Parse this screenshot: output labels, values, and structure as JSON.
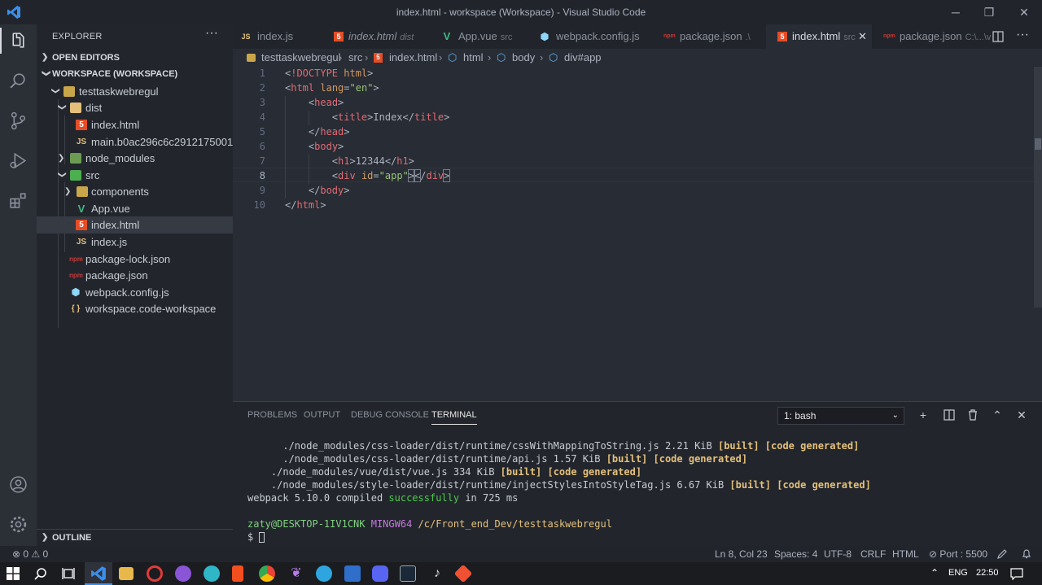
{
  "window": {
    "title": "index.html - workspace (Workspace) - Visual Studio Code"
  },
  "sidebar": {
    "header": "EXPLORER",
    "more": "···",
    "open_editors": "OPEN EDITORS",
    "workspace": "WORKSPACE (WORKSPACE)",
    "outline": "OUTLINE",
    "tree": [
      {
        "label": "testtaskwebregul"
      },
      {
        "label": "dist"
      },
      {
        "label": "index.html"
      },
      {
        "label": "main.b0ac296c6c2912175001.js"
      },
      {
        "label": "node_modules"
      },
      {
        "label": "src"
      },
      {
        "label": "components"
      },
      {
        "label": "App.vue"
      },
      {
        "label": "index.html"
      },
      {
        "label": "index.js"
      },
      {
        "label": "package-lock.json"
      },
      {
        "label": "package.json"
      },
      {
        "label": "webpack.config.js"
      },
      {
        "label": "workspace.code-workspace"
      }
    ]
  },
  "tabs": [
    {
      "label": "index.js",
      "desc": ""
    },
    {
      "label": "index.html",
      "desc": "dist"
    },
    {
      "label": "App.vue",
      "desc": "src"
    },
    {
      "label": "webpack.config.js",
      "desc": ""
    },
    {
      "label": "package.json",
      "desc": ".\\"
    },
    {
      "label": "index.html",
      "desc": "src"
    },
    {
      "label": "package.json",
      "desc": "C:\\...\\v"
    }
  ],
  "breadcrumb": {
    "items": [
      "testtaskwebregul",
      "src",
      "index.html",
      "html",
      "body",
      "div#app"
    ],
    "sep": "›"
  },
  "editor": {
    "line_numbers": [
      "1",
      "2",
      "3",
      "4",
      "5",
      "6",
      "7",
      "8",
      "9",
      "10"
    ]
  },
  "panel": {
    "tabs": [
      "PROBLEMS",
      "OUTPUT",
      "DEBUG CONSOLE",
      "TERMINAL"
    ],
    "terminal_select": "1: bash",
    "lines": {
      "l1a": "      ./node_modules/css-loader/dist/runtime/cssWithMappingToString.js 2.21 KiB ",
      "l2a": "      ./node_modules/css-loader/dist/runtime/api.js 1.57 KiB ",
      "l3a": "    ./node_modules/vue/dist/vue.js 334 KiB ",
      "l4a": "    ./node_modules/style-loader/dist/runtime/injectStylesIntoStyleTag.js 6.67 KiB ",
      "built": "[built] [code generated]",
      "l5a": "webpack 5.10.0 compiled ",
      "l5b": "successfully",
      "l5c": " in 725 ms",
      "user": "zaty@DESKTOP-1IV1CNK",
      "shell": "MINGW64",
      "path": "/c/Front_end_Dev/testtaskwebregul",
      "prompt": "$ "
    }
  },
  "status": {
    "errors": "⊗ 0 ⚠ 0",
    "position": "Ln 8, Col 23",
    "spaces": "Spaces: 4",
    "encoding": "UTF-8",
    "eol": "CRLF",
    "language": "HTML",
    "port": "⊘ Port : 5500"
  },
  "taskbar": {
    "lang": "ENG",
    "time": "22:50"
  },
  "colors": {
    "accent": "#3b8eea",
    "tag": "#e06c75",
    "attr": "#d19a66",
    "string": "#98c379",
    "html_icon": "#e44d26",
    "js_icon": "#e5c07b",
    "vue_icon": "#41b883"
  }
}
